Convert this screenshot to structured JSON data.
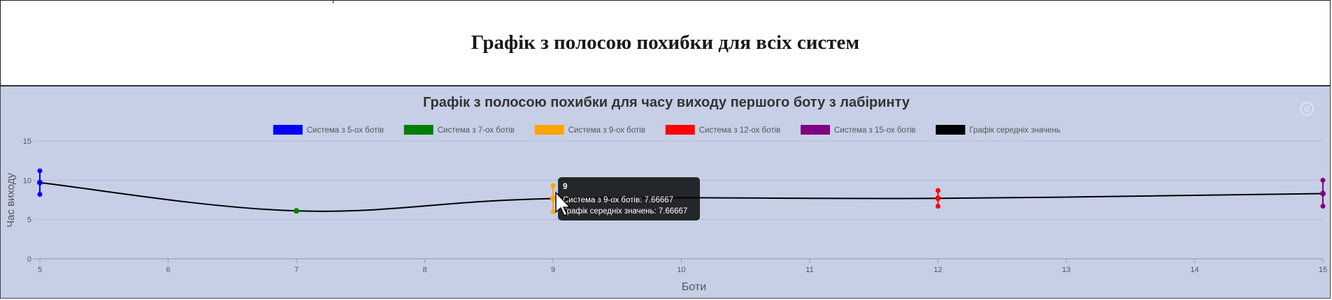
{
  "page": {
    "title": "Графік з полосою похибки для всіх систем"
  },
  "chart_data": {
    "type": "line",
    "title": "Графік з полосою похибки для часу виходу першого боту з лабіринту",
    "xlabel": "Боти",
    "ylabel": "Час виходу",
    "xlim": [
      5,
      15
    ],
    "ylim": [
      0,
      15
    ],
    "x_ticks": [
      "5",
      "6",
      "7",
      "8",
      "9",
      "10",
      "11",
      "12",
      "13",
      "14",
      "15"
    ],
    "y_ticks": [
      "0",
      "5",
      "10",
      "15"
    ],
    "grid": true,
    "legend_position": "top-center",
    "series": [
      {
        "name": "Система з 5-ох ботів",
        "color": "#0000ff",
        "x": 5,
        "y": 9.7,
        "ymin": 8.2,
        "ymax": 11.2
      },
      {
        "name": "Система з 7-ох ботів",
        "color": "#008000",
        "x": 7,
        "y": 6.1,
        "ymin": 6.1,
        "ymax": 6.1
      },
      {
        "name": "Система з 9-ох ботів",
        "color": "#ffa500",
        "x": 9,
        "y": 7.66667,
        "ymin": 6.0,
        "ymax": 9.3
      },
      {
        "name": "Система з 12-ох ботів",
        "color": "#ff0000",
        "x": 12,
        "y": 7.7,
        "ymin": 6.7,
        "ymax": 8.7
      },
      {
        "name": "Система з 15-ох ботів",
        "color": "#800080",
        "x": 15,
        "y": 8.3,
        "ymin": 6.7,
        "ymax": 10.0
      },
      {
        "name": "Графік середніх значень",
        "color": "#000000",
        "x": [
          5,
          7,
          9,
          12,
          15
        ],
        "y": [
          9.7,
          6.1,
          7.66667,
          7.7,
          8.3
        ]
      }
    ],
    "tooltip": {
      "title": "9",
      "lines": [
        "Система з 9-ох ботів: 7.66667",
        "Графік середніх значень: 7.66667"
      ]
    }
  }
}
